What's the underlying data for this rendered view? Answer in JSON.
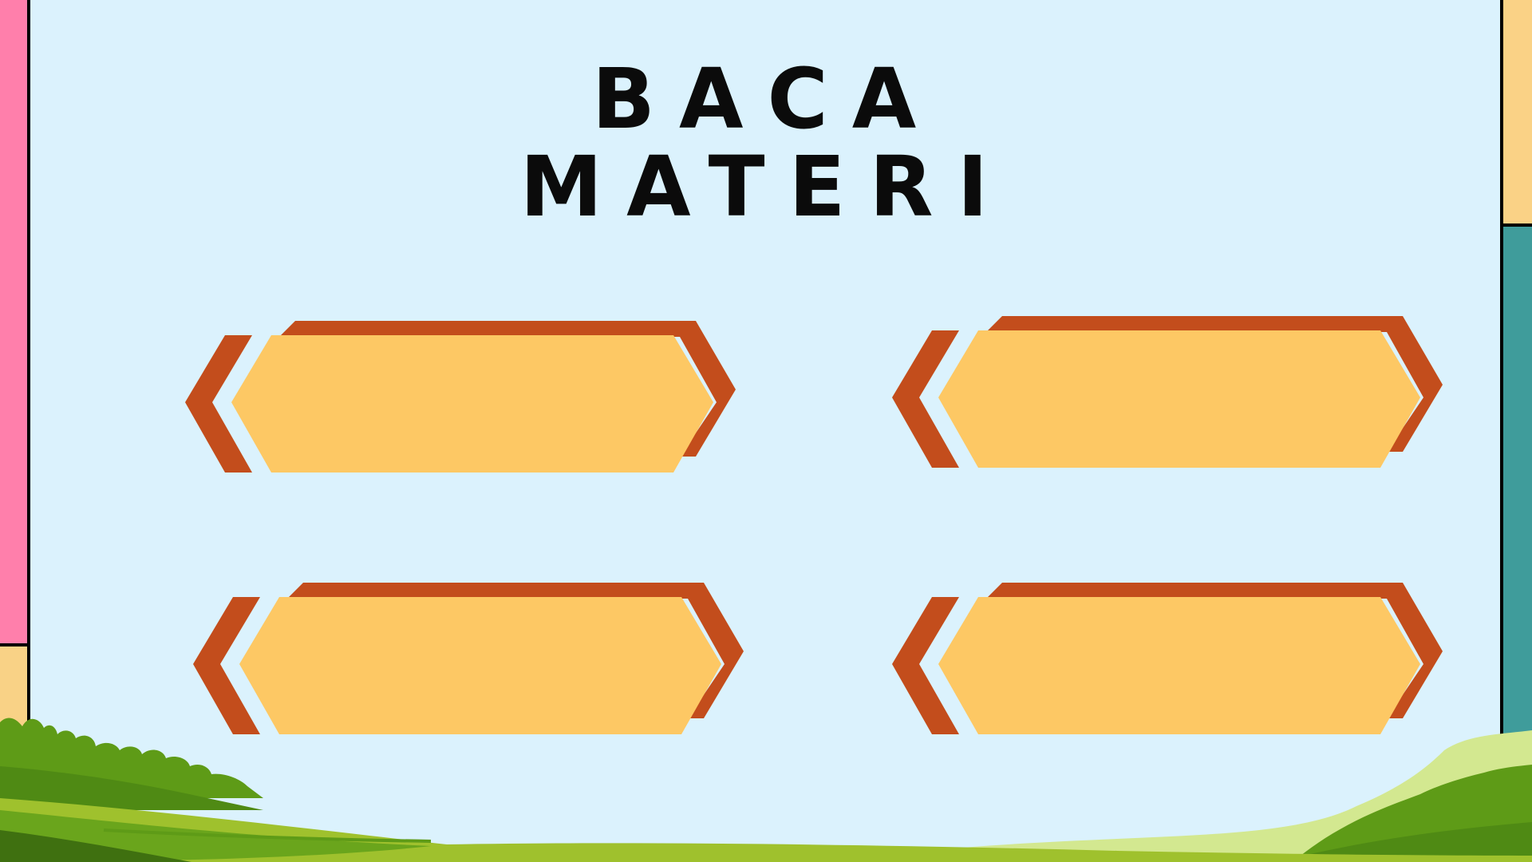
{
  "title": {
    "line1": "BACA",
    "line2": "MATERI"
  },
  "colors": {
    "background": "#dbf2fd",
    "banner_fill": "#fdc864",
    "banner_shadow": "#c34d1c",
    "left_strip_top": "#ff7fab",
    "left_strip_bottom": "#f9d286",
    "right_strip_top": "#fad286",
    "right_strip_bottom": "#3f9c9b",
    "grass_dark": "#4f8a14",
    "grass_light": "#9fc12d"
  },
  "banners": [
    {
      "name": "materi-1",
      "label": ""
    },
    {
      "name": "materi-2",
      "label": ""
    },
    {
      "name": "materi-3",
      "label": ""
    },
    {
      "name": "materi-4",
      "label": ""
    }
  ]
}
